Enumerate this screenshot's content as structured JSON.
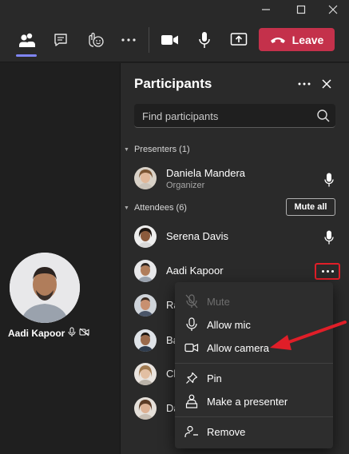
{
  "window": {
    "controls": [
      {
        "icon": "minimize-icon"
      },
      {
        "icon": "maximize-icon"
      },
      {
        "icon": "close-window-icon"
      }
    ]
  },
  "toolbar": {
    "buttons": [
      {
        "icon": "participants-icon",
        "active": true
      },
      {
        "icon": "chat-icon"
      },
      {
        "icon": "reactions-icon"
      },
      {
        "icon": "more-options-icon"
      },
      {
        "icon": "camera-icon"
      },
      {
        "icon": "microphone-icon"
      },
      {
        "icon": "share-screen-icon"
      }
    ],
    "leave_label": "Leave",
    "leave_color": "#c4314b",
    "accent_color": "#7f85f5"
  },
  "stage": {
    "name": "Aadi Kapoor"
  },
  "panel": {
    "title": "Participants",
    "search_placeholder": "Find participants",
    "presenters_header": "Presenters (1)",
    "attendees_header": "Attendees (6)",
    "mute_all_label": "Mute all",
    "presenters": [
      {
        "name": "Daniela Mandera",
        "role": "Organizer",
        "mic": true
      }
    ],
    "attendees": [
      {
        "name": "Serena Davis",
        "mic": true
      },
      {
        "name": "Aadi Kapoor",
        "highlighted_more": true
      },
      {
        "name": "Ra"
      },
      {
        "name": "Ba"
      },
      {
        "name": "Ch"
      },
      {
        "name": "Da"
      }
    ]
  },
  "context_menu": {
    "items": [
      {
        "label": "Mute",
        "icon": "mic-off-icon",
        "disabled": true
      },
      {
        "label": "Allow mic",
        "icon": "microphone-icon"
      },
      {
        "label": "Allow camera",
        "icon": "camera-icon"
      },
      {
        "label": "Pin",
        "icon": "pin-icon"
      },
      {
        "label": "Make a presenter",
        "icon": "presenter-icon"
      },
      {
        "label": "Remove",
        "icon": "remove-person-icon"
      }
    ]
  },
  "annotation": {
    "highlight_color": "#e01e28"
  }
}
